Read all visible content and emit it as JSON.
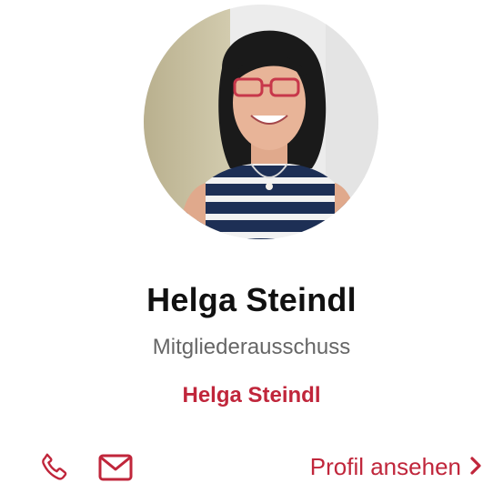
{
  "colors": {
    "accent": "#c0263b",
    "name": "#111111",
    "role": "#666666"
  },
  "profile": {
    "name": "Helga Steindl",
    "role": "Mitgliederausschuss",
    "link_name": "Helga Steindl"
  },
  "actions": {
    "phone_icon": "phone-icon",
    "mail_icon": "mail-icon",
    "profile_link_label": "Profil ansehen",
    "chevron_icon": "chevron-right-icon"
  }
}
